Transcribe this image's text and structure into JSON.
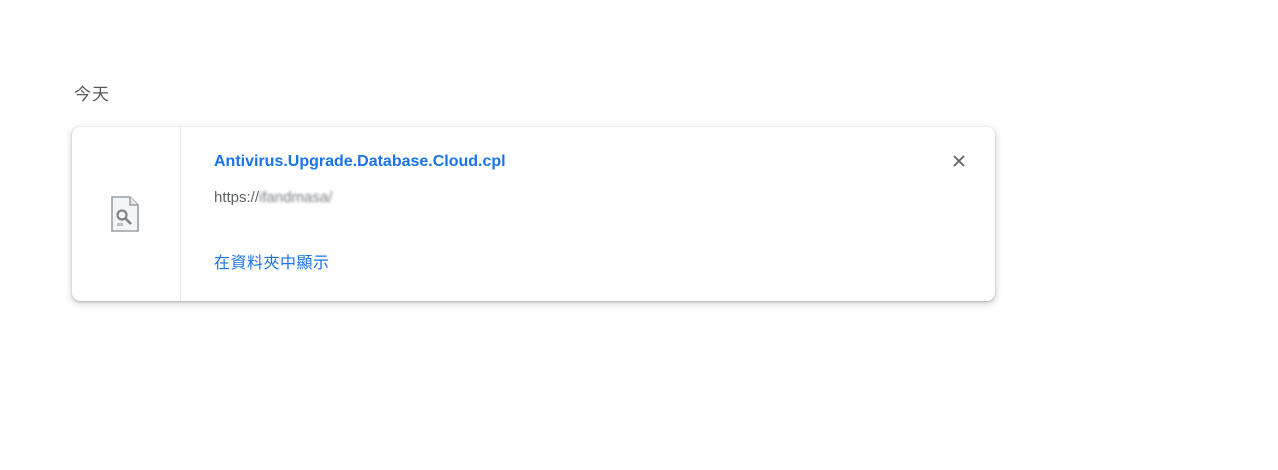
{
  "downloads": {
    "section_header": "今天",
    "items": [
      {
        "file_name": "Antivirus.Upgrade.Database.Cloud.cpl",
        "url_prefix": "https://",
        "url_redacted": "ifandmasa/",
        "show_in_folder_label": "在資料夾中顯示",
        "file_icon": "generic-file-icon",
        "remove_icon": "close-icon"
      }
    ]
  },
  "colors": {
    "link": "#1a73e8",
    "secondary_text": "#5f6368",
    "card_background": "#ffffff"
  }
}
